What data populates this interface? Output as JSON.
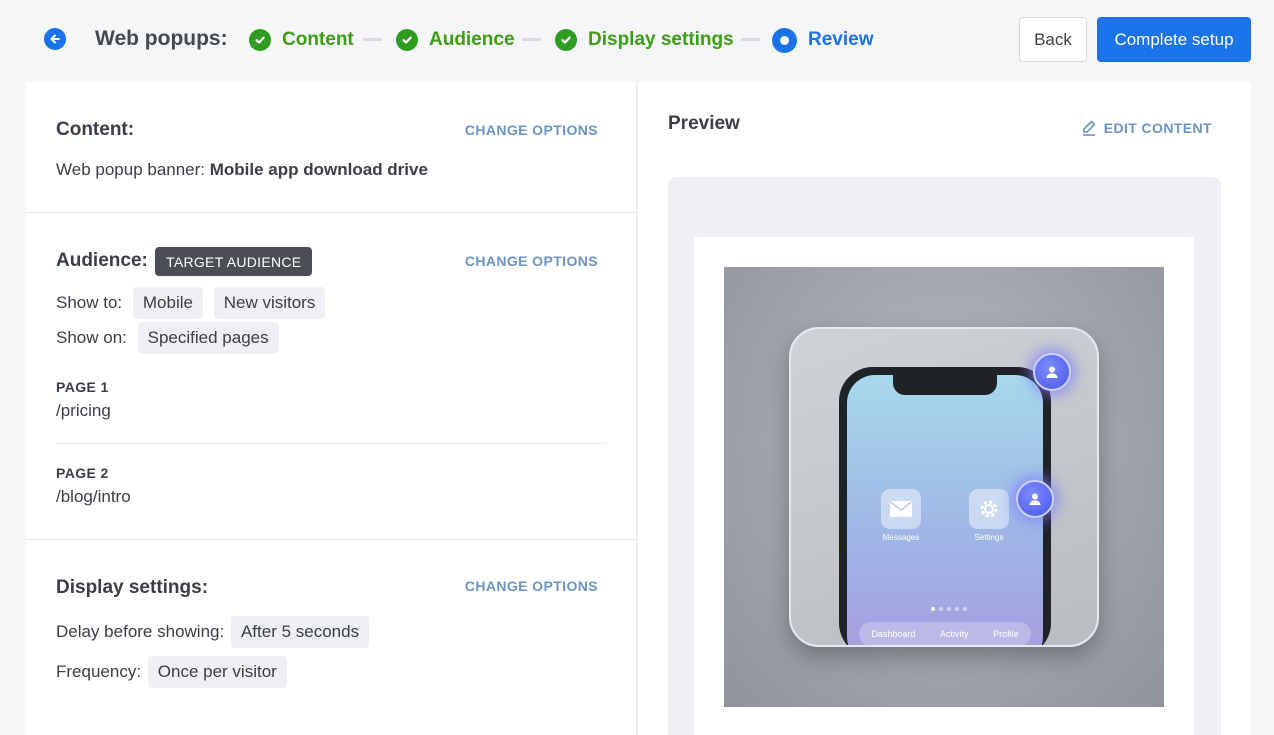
{
  "header": {
    "title": "Web popups:",
    "steps": [
      {
        "label": "Content",
        "state": "done"
      },
      {
        "label": "Audience",
        "state": "done"
      },
      {
        "label": "Display settings",
        "state": "done"
      },
      {
        "label": "Review",
        "state": "active"
      }
    ],
    "back_label": "Back",
    "complete_label": "Complete setup"
  },
  "content_section": {
    "title": "Content:",
    "change_label": "CHANGE OPTIONS",
    "prefix": "Web popup banner: ",
    "banner_name": "Mobile app download drive"
  },
  "audience_section": {
    "title": "Audience:",
    "badge": "TARGET AUDIENCE",
    "change_label": "CHANGE OPTIONS",
    "show_to_label": "Show to:",
    "show_to_chips": [
      "Mobile",
      "New visitors"
    ],
    "show_on_label": "Show on:",
    "show_on_chips": [
      "Specified pages"
    ],
    "pages": [
      {
        "label": "PAGE 1",
        "path": "/pricing"
      },
      {
        "label": "PAGE 2",
        "path": "/blog/intro"
      }
    ]
  },
  "display_section": {
    "title": "Display settings:",
    "change_label": "CHANGE OPTIONS",
    "delay_label": "Delay before showing:",
    "delay_value": "After 5 seconds",
    "frequency_label": "Frequency:",
    "frequency_value": "Once per visitor"
  },
  "preview": {
    "title": "Preview",
    "edit_label": "EDIT CONTENT",
    "app_labels": [
      "Messages",
      "Settings"
    ],
    "dock_labels": [
      "Dashboard",
      "Activity",
      "Profile"
    ]
  },
  "colors": {
    "primary": "#1a73e8",
    "success": "#3c9e12",
    "link": "#6b93c4"
  }
}
